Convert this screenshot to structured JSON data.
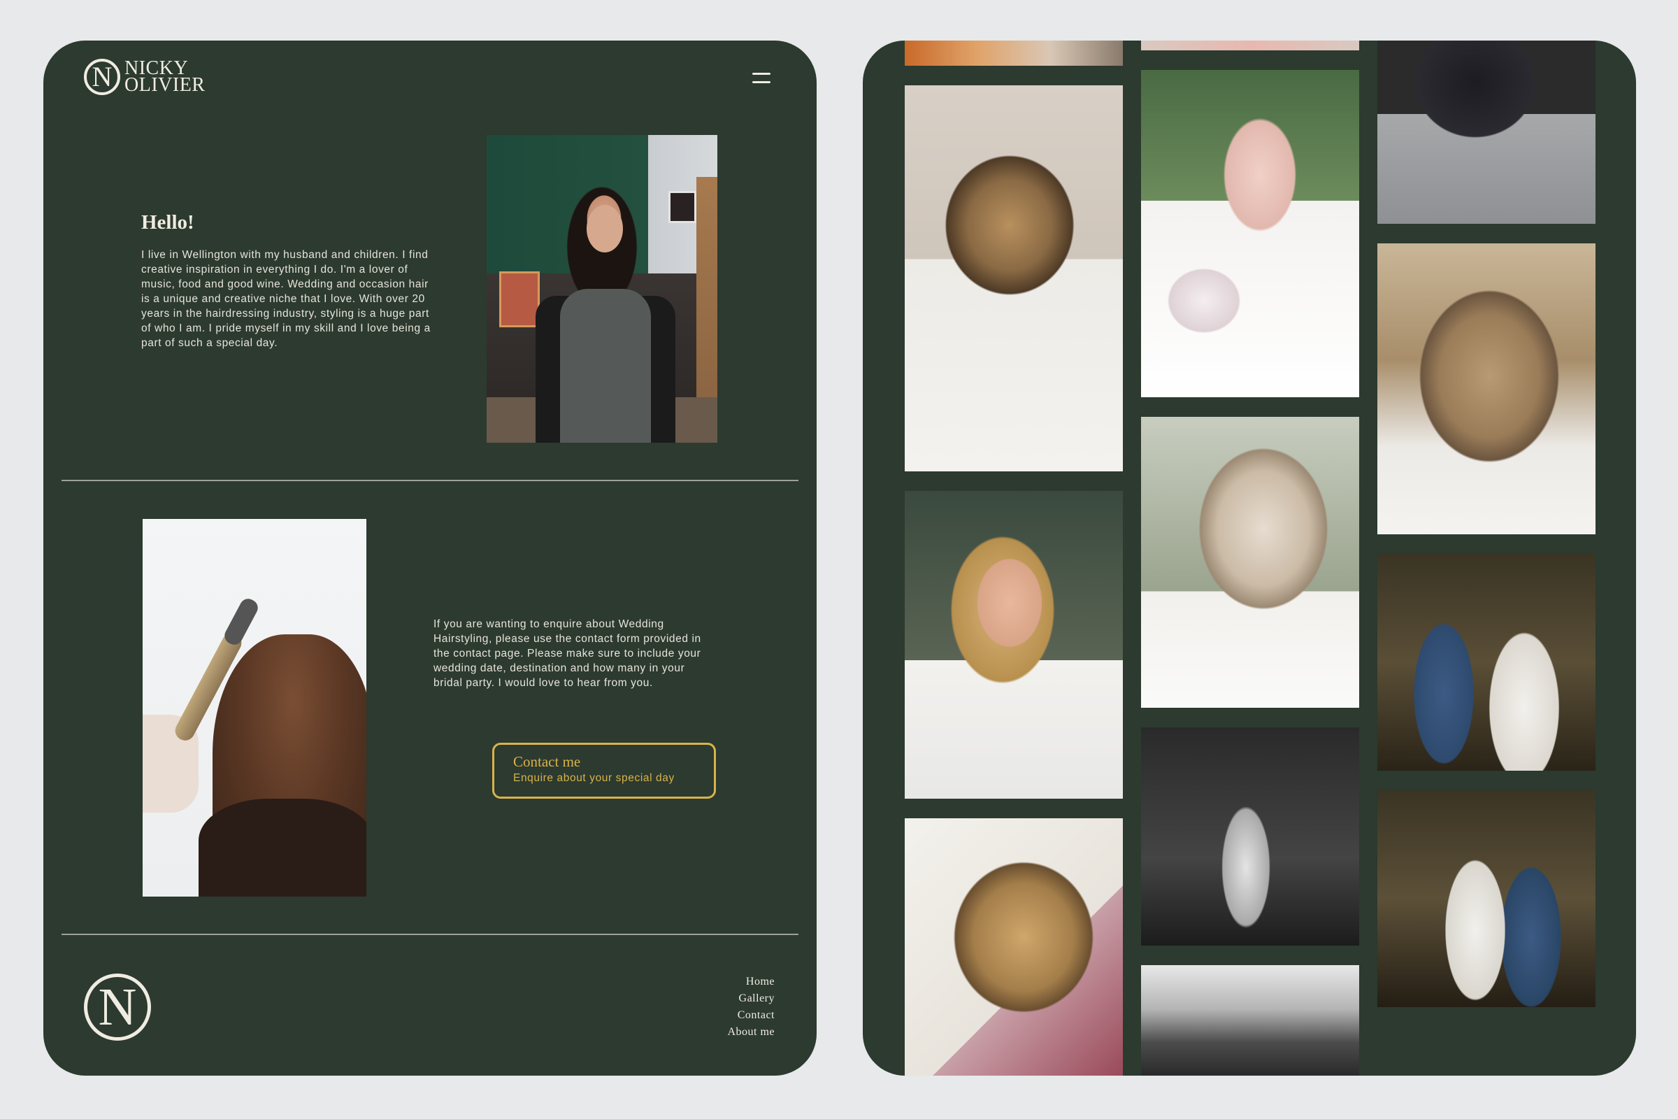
{
  "brand": {
    "name_line1": "NICKY",
    "name_line2": "OLIVIER",
    "monogram": "N"
  },
  "intro": {
    "title": "Hello!",
    "body": "I live in Wellington with my husband and children. I find creative inspiration in everything I do. I'm a lover of music, food and good wine. Wedding and occasion hair is a unique and creative niche that I love. With over 20 years in the hairdressing industry, styling is a huge part of who I am. I pride myself in my skill and I love being a part of such a special day."
  },
  "enquire": {
    "body": "If you are wanting to enquire about Wedding Hairstyling, please use the contact form provided in the contact page. Please make sure to include your wedding date, destination and how many in your bridal party. I would love to hear from you.",
    "button_title": "Contact me",
    "button_subtitle": "Enquire about your special day"
  },
  "footer_nav": [
    "Home",
    "Gallery",
    "Contact",
    "About me"
  ],
  "colors": {
    "background": "#e7e9ea",
    "panel": "#2c3a2f",
    "text": "#f0ece2",
    "accent": "#d9b24a"
  }
}
